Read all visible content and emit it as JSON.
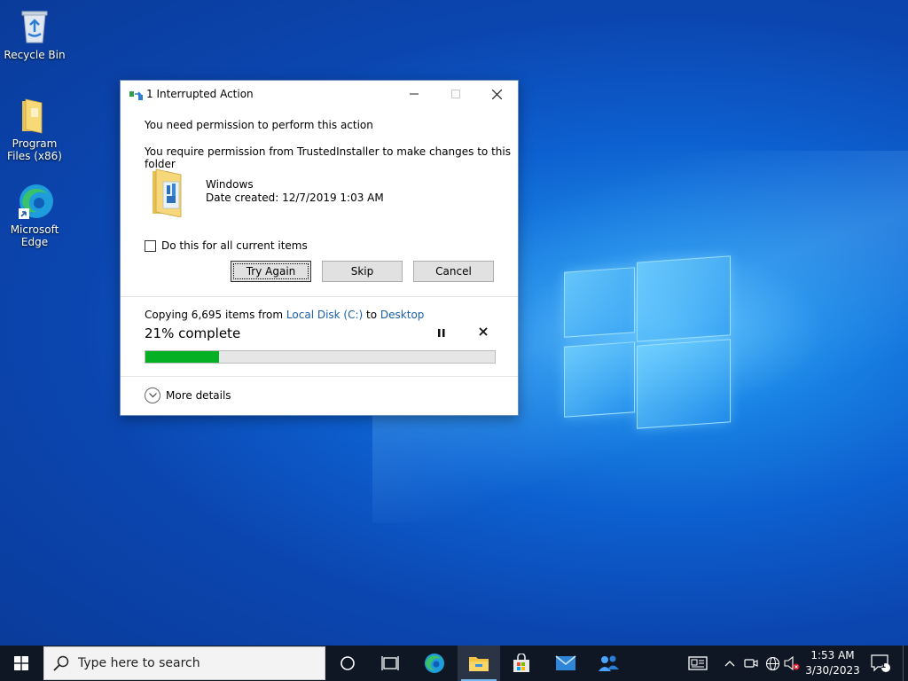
{
  "desktop": {
    "icons": [
      {
        "label": "Recycle Bin"
      },
      {
        "label": "Program Files (x86)"
      },
      {
        "label": "Microsoft Edge"
      }
    ]
  },
  "dialog": {
    "title": "1 Interrupted Action",
    "message_primary": "You need permission to perform this action",
    "message_secondary": "You require permission from TrustedInstaller to make changes to this folder",
    "item": {
      "name": "Windows",
      "date_created": "Date created: 12/7/2019 1:03 AM"
    },
    "apply_all_label": "Do this for all current items",
    "apply_all_checked": false,
    "buttons": {
      "try_again": "Try Again",
      "skip": "Skip",
      "cancel": "Cancel"
    },
    "progress": {
      "copying_prefix": "Copying 6,695 items from",
      "source": "Local Disk (C:)",
      "to_word": "to",
      "destination": "Desktop",
      "percent_label": "21% complete",
      "percent_value": 21
    },
    "more_details": "More details"
  },
  "taskbar": {
    "search_placeholder": "Type here to search",
    "apps": [
      "cortana-icon",
      "task-view-icon",
      "edge-icon",
      "file-explorer-icon",
      "store-icon",
      "mail-icon",
      "people-icon"
    ],
    "clock": {
      "time": "1:53 AM",
      "date": "3/30/2023"
    },
    "notification_count": "1"
  },
  "colors": {
    "progress_fill": "#06b025",
    "link": "#1a5fa8",
    "taskbar": "#101724"
  }
}
